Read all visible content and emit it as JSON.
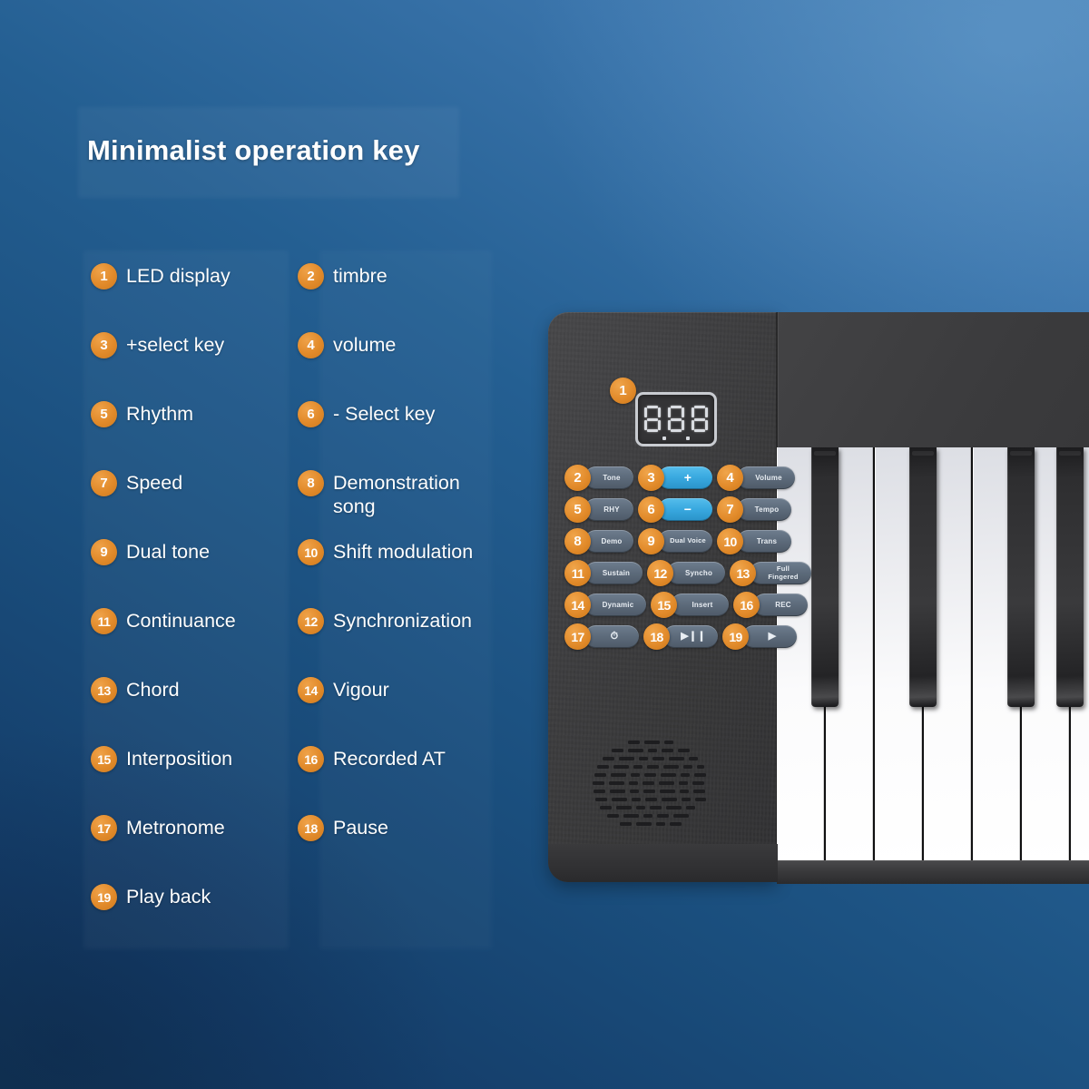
{
  "title": "Minimalist operation key",
  "legend": {
    "rows": [
      [
        {
          "num": "1",
          "label": "LED display"
        },
        {
          "num": "2",
          "label": "timbre"
        }
      ],
      [
        {
          "num": "3",
          "label": "+select key"
        },
        {
          "num": "4",
          "label": "volume"
        }
      ],
      [
        {
          "num": "5",
          "label": "Rhythm"
        },
        {
          "num": "6",
          "label": "- Select key"
        }
      ],
      [
        {
          "num": "7",
          "label": "Speed"
        },
        {
          "num": "8",
          "label": "Demonstration song"
        }
      ],
      [
        {
          "num": "9",
          "label": "Dual tone"
        },
        {
          "num": "10",
          "label": "Shift modulation"
        }
      ],
      [
        {
          "num": "11",
          "label": "Continuance"
        },
        {
          "num": "12",
          "label": "Synchronization"
        }
      ],
      [
        {
          "num": "13",
          "label": "Chord"
        },
        {
          "num": "14",
          "label": "Vigour"
        }
      ],
      [
        {
          "num": "15",
          "label": "Interposition"
        },
        {
          "num": "16",
          "label": "Recorded AT"
        }
      ],
      [
        {
          "num": "17",
          "label": "Metronome"
        },
        {
          "num": "18",
          "label": "Pause"
        }
      ],
      [
        {
          "num": "19",
          "label": "Play back"
        },
        {
          "num": "",
          "label": ""
        }
      ]
    ]
  },
  "device": {
    "display": {
      "badge": "1",
      "value": "8.8.8"
    },
    "buttons": [
      [
        {
          "num": "2",
          "label": "Tone",
          "style": "grey"
        },
        {
          "num": "3",
          "label": "+",
          "style": "cyan"
        },
        {
          "num": "4",
          "label": "Volume",
          "style": "grey"
        }
      ],
      [
        {
          "num": "5",
          "label": "RHY",
          "style": "grey"
        },
        {
          "num": "6",
          "label": "−",
          "style": "cyan"
        },
        {
          "num": "7",
          "label": "Tempo",
          "style": "grey"
        }
      ],
      [
        {
          "num": "8",
          "label": "Demo",
          "style": "grey"
        },
        {
          "num": "9",
          "label": "Dual Voice",
          "style": "grey"
        },
        {
          "num": "10",
          "label": "Trans",
          "style": "grey"
        }
      ],
      [
        {
          "num": "11",
          "label": "Sustain",
          "style": "grey"
        },
        {
          "num": "12",
          "label": "Syncho",
          "style": "grey"
        },
        {
          "num": "13",
          "label": "Full Fingered",
          "style": "grey"
        }
      ],
      [
        {
          "num": "14",
          "label": "Dynamic",
          "style": "grey"
        },
        {
          "num": "15",
          "label": "Insert",
          "style": "grey"
        },
        {
          "num": "16",
          "label": "REC",
          "style": "grey"
        }
      ],
      [
        {
          "num": "17",
          "label": "metronome-icon",
          "style": "grey"
        },
        {
          "num": "18",
          "label": "play-pause-icon",
          "style": "grey"
        },
        {
          "num": "19",
          "label": "play-icon",
          "style": "grey"
        }
      ]
    ],
    "speaker_label": "speaker-grille"
  },
  "colors": {
    "accent_orange": "#e28b2b",
    "cyan_button": "#39a9e0",
    "grey_button": "#5d6b7b",
    "bg_light": "#4179b0",
    "bg_dark": "#143c68",
    "device_body": "#3a3a3c"
  }
}
